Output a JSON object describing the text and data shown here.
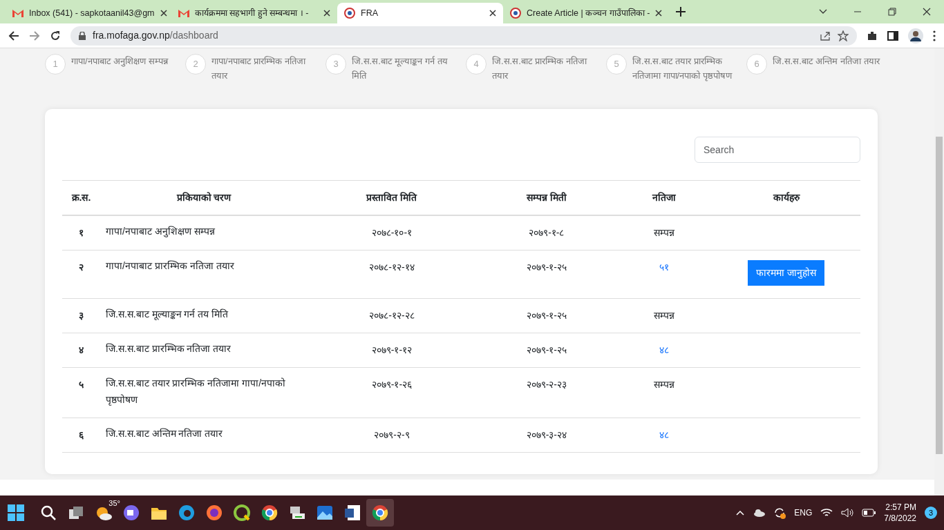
{
  "browser": {
    "tabs": [
      {
        "title": "Inbox (541) - sapkotaanil43@gm",
        "kind": "mail",
        "selected": false
      },
      {
        "title": "कार्यक्रममा सहभागी हुने सम्बन्धमा । -",
        "kind": "mail",
        "selected": false
      },
      {
        "title": "FRA",
        "kind": "site",
        "selected": true
      },
      {
        "title": "Create Article | कञ्चन गाउँपालिका -",
        "kind": "site",
        "selected": false
      }
    ],
    "address": {
      "host": "fra.mofaga.gov.np",
      "path": "/dashboard"
    }
  },
  "steps": [
    {
      "number": "1",
      "label": "गापा/नपाबाट अनुशिक्षण सम्पन्न"
    },
    {
      "number": "2",
      "label": "गापा/नपाबाट प्रारम्भिक नतिजा तयार"
    },
    {
      "number": "3",
      "label": "जि.स.स.बाट मूल्याङ्कन गर्न तय मिति"
    },
    {
      "number": "4",
      "label": "जि.स.स.बाट प्रारम्भिक नतिजा तयार"
    },
    {
      "number": "5",
      "label": "जि.स.स.बाट तयार प्रारम्भिक नतिजामा गापा/नपाको पृष्ठपोषण"
    },
    {
      "number": "6",
      "label": "जि.स.स.बाट अन्तिम नतिजा तयार"
    }
  ],
  "search": {
    "placeholder": "Search"
  },
  "table": {
    "columns": [
      "क्र.स.",
      "प्रकियाको चरण",
      "प्रस्तावित मिति",
      "सम्पन्न मिती",
      "नतिजा",
      "कार्यहरु"
    ],
    "rows": [
      {
        "sn": "१",
        "stage": "गापा/नपाबाट अनुशिक्षण सम्पन्न",
        "proposed": "२०७८-१०-१",
        "completed": "२०७९-१-८",
        "result": {
          "kind": "text",
          "text": "सम्पन्न"
        }
      },
      {
        "sn": "२",
        "stage": "गापा/नपाबाट प्रारम्भिक नतिजा तयार",
        "proposed": "२०७८-१२-१४",
        "completed": "२०७९-१-२५",
        "result": {
          "kind": "link",
          "text": "५१"
        },
        "action": "फारममा जानुहोस"
      },
      {
        "sn": "३",
        "stage": "जि.स.स.बाट मूल्याङ्कन गर्न तय मिति",
        "proposed": "२०७८-१२-२८",
        "completed": "२०७९-१-२५",
        "result": {
          "kind": "text",
          "text": "सम्पन्न"
        }
      },
      {
        "sn": "४",
        "stage": "जि.स.स.बाट प्रारम्भिक नतिजा तयार",
        "proposed": "२०७९-१-१२",
        "completed": "२०७९-१-२५",
        "result": {
          "kind": "link",
          "text": "४८"
        }
      },
      {
        "sn": "५",
        "stage": "जि.स.स.बाट तयार प्रारम्भिक नतिजामा गापा/नपाको पृष्ठपोषण",
        "proposed": "२०७९-१-२६",
        "completed": "२०७९-२-२३",
        "result": {
          "kind": "text",
          "text": "सम्पन्न"
        }
      },
      {
        "sn": "६",
        "stage": "जि.स.स.बाट अन्तिम नतिजा तयार",
        "proposed": "२०७९-२-९",
        "completed": "२०७९-३-२४",
        "result": {
          "kind": "link",
          "text": "४८"
        }
      }
    ]
  },
  "taskbar": {
    "weather": "35°",
    "language": "ENG",
    "time": "2:57 PM",
    "date": "7/8/2022",
    "notifications": "3"
  }
}
